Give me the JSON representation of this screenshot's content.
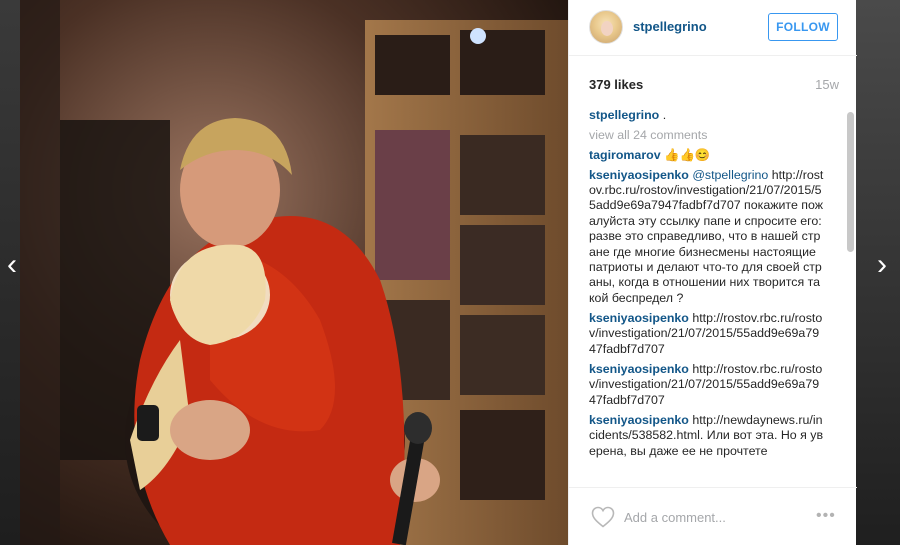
{
  "post": {
    "username": "stpellegrino",
    "follow_label": "FOLLOW",
    "likes": "379 likes",
    "age": "15w",
    "caption_text": "."
  },
  "comments": {
    "view_all": "view all 24 comments",
    "items": [
      {
        "user": "tagiromarov",
        "text": "👍👍😊"
      },
      {
        "user": "kseniyaosipenko",
        "mention": "@stpellegrino",
        "text": "http://rostov.rbc.ru/rostov/investigation/21/07/2015/55add9e69a7947fadbf7d707 покажите пожалуйста эту ссылку папе и спросите его: разве это справедливо, что в нашей стране где многие бизнесмены настоящие патриоты и делают что-то для своей страны, когда в отношении них творится такой беспредел ?"
      },
      {
        "user": "kseniyaosipenko",
        "text": "http://rostov.rbc.ru/rostov/investigation/21/07/2015/55add9e69a7947fadbf7d707"
      },
      {
        "user": "kseniyaosipenko",
        "text": "http://rostov.rbc.ru/rostov/investigation/21/07/2015/55add9e69a7947fadbf7d707"
      },
      {
        "user": "kseniyaosipenko",
        "text": "http://newdaynews.ru/incidents/538582.html. Или вот эта. Но я уверена, вы даже ее не прочтете"
      }
    ]
  },
  "footer": {
    "comment_placeholder": "Add a comment...",
    "more_glyph": "•••"
  },
  "nav": {
    "prev_glyph": "‹",
    "next_glyph": "›"
  },
  "icons": {
    "heart": "heart-icon",
    "more": "more-options-icon",
    "prev": "chevron-left-icon",
    "next": "chevron-right-icon"
  },
  "colors": {
    "link_blue": "#125688",
    "follow_blue": "#3897f0",
    "muted_grey": "#a5a7aa",
    "text_dark": "#262626"
  }
}
